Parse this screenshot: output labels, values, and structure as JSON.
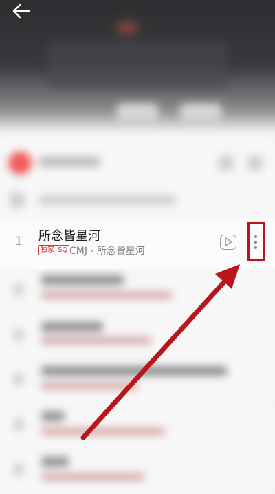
{
  "header": {
    "back_icon": "arrow-left-icon"
  },
  "songs": [
    {
      "index": "1",
      "title": "所念皆星河",
      "tags": [
        "独家",
        "SQ"
      ],
      "artist_album": "CMJ - 所念皆星河",
      "play_icon": "play-video-icon",
      "more_icon": "more-vertical-icon"
    }
  ],
  "annotation": {
    "highlight_color": "#b8161c",
    "arrow_color": "#b8161c"
  }
}
